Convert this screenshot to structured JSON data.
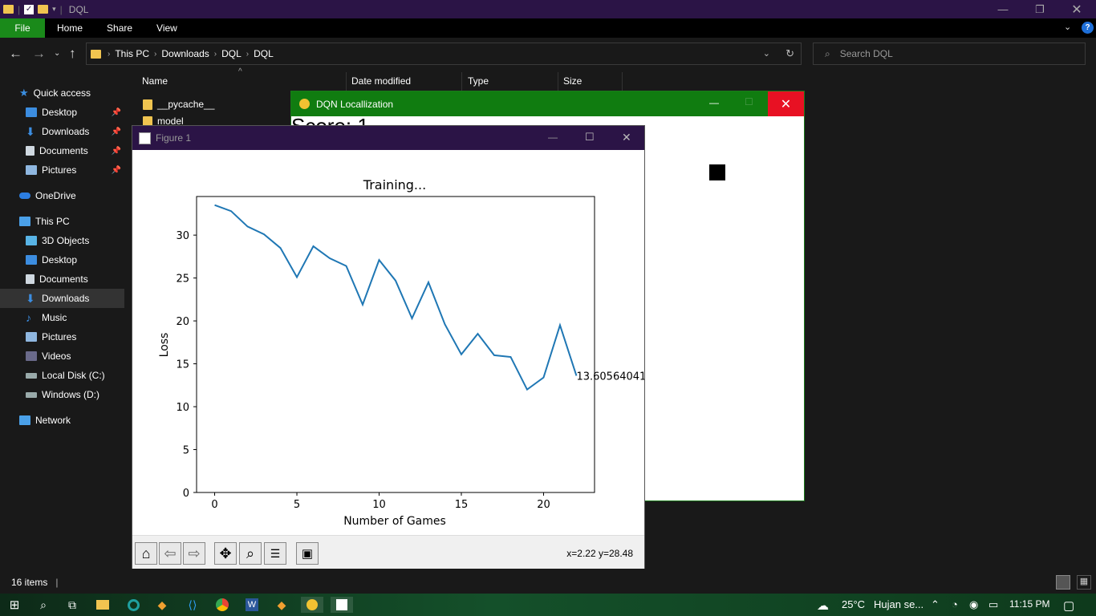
{
  "explorer": {
    "title": "DQL",
    "tabs": [
      "File",
      "Home",
      "Share",
      "View"
    ],
    "breadcrumbs": [
      "This PC",
      "Downloads",
      "DQL",
      "DQL"
    ],
    "search_placeholder": "Search DQL",
    "columns": [
      "Name",
      "Date modified",
      "Type",
      "Size"
    ],
    "files": [
      "__pycache__",
      "model"
    ],
    "status": "16 items",
    "nav": {
      "quick_access": "Quick access",
      "quick_items": [
        "Desktop",
        "Downloads",
        "Documents",
        "Pictures"
      ],
      "onedrive": "OneDrive",
      "this_pc": "This PC",
      "pc_items": [
        "3D Objects",
        "Desktop",
        "Documents",
        "Downloads",
        "Music",
        "Pictures",
        "Videos",
        "Local Disk (C:)",
        "Windows (D:)"
      ],
      "network": "Network",
      "selected": "Downloads"
    }
  },
  "dqn_window": {
    "title": "DQN Locallization",
    "score_text": "Score: 1"
  },
  "figure": {
    "window_title": "Figure 1",
    "coords": "x=2.22 y=28.48",
    "toolbar": [
      "home-icon",
      "back-icon",
      "forward-icon",
      "pan-icon",
      "zoom-icon",
      "configure-icon",
      "save-icon"
    ]
  },
  "chart_data": {
    "type": "line",
    "title": "Training...",
    "xlabel": "Number of Games",
    "ylabel": "Loss",
    "x": [
      0,
      1,
      2,
      3,
      4,
      5,
      6,
      7,
      8,
      9,
      10,
      11,
      12,
      13,
      14,
      15,
      16,
      17,
      18,
      19,
      20,
      21,
      22
    ],
    "series": [
      {
        "values": [
          33.5,
          32.8,
          31.0,
          30.1,
          28.5,
          25.1,
          28.7,
          27.3,
          26.4,
          21.9,
          27.1,
          24.7,
          20.3,
          24.5,
          19.6,
          16.1,
          18.5,
          16.0,
          15.8,
          12.0,
          13.4,
          19.5,
          13.6056404
        ]
      }
    ],
    "last_label": "13.60564041",
    "xlim": [
      -1.1,
      23.1
    ],
    "ylim": [
      0,
      34.5
    ],
    "xticks": [
      0,
      5,
      10,
      15,
      20
    ],
    "yticks": [
      0,
      5,
      10,
      15,
      20,
      25,
      30
    ],
    "color": "#1f77b4",
    "grid": false
  },
  "taskbar": {
    "weather": "25°C",
    "weather_text": "Hujan se...",
    "time": "11:15 PM"
  }
}
